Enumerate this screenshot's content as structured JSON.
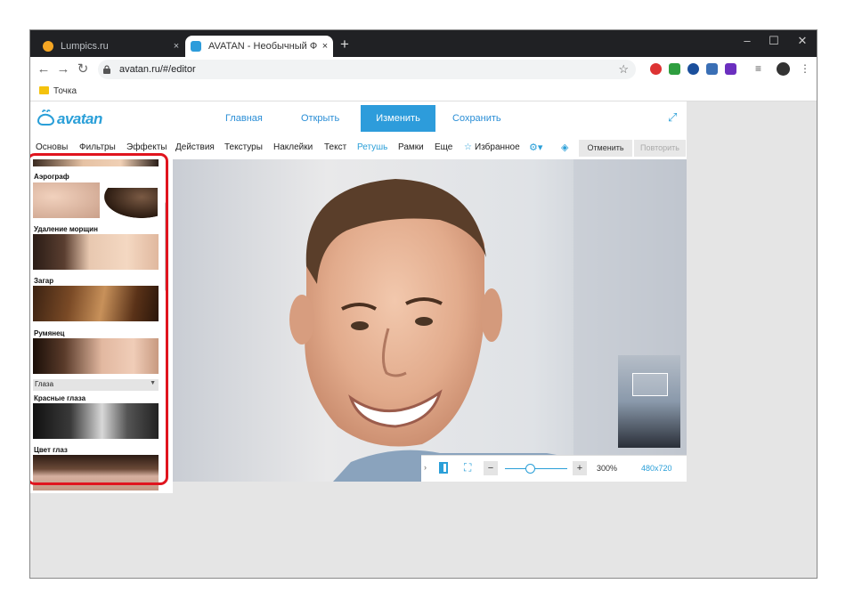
{
  "browser": {
    "tabs": [
      {
        "title": "Lumpics.ru",
        "close": "×"
      },
      {
        "title": "AVATAN - Необычный Фоторед",
        "close": "×"
      }
    ],
    "new_tab": "+",
    "window_controls": {
      "minimize": "–",
      "maximize": "☐",
      "close": "✕"
    },
    "url": "avatan.ru/#/editor",
    "bookmark": "Точка",
    "colors": {
      "tabstrip": "#202124",
      "accent": "#2d9cdb"
    }
  },
  "app": {
    "logo": "avatan",
    "nav": {
      "home": "Главная",
      "open": "Открыть",
      "edit": "Изменить",
      "save": "Сохранить"
    },
    "menu": [
      "Основы",
      "Фильтры",
      "Эффекты",
      "Действия",
      "Текстуры",
      "Наклейки",
      "Текст",
      "Ретушь",
      "Рамки",
      "Еще"
    ],
    "active_menu": "Ретушь",
    "favorites": "Избранное",
    "undo": "Отменить",
    "redo": "Повторить"
  },
  "panel": {
    "items": [
      {
        "label": "Аэрограф"
      },
      {
        "label": "Удаление морщин"
      },
      {
        "label": "Загар"
      },
      {
        "label": "Румянец"
      }
    ],
    "section": "Глаза",
    "eye_items": [
      {
        "label": "Красные глаза"
      },
      {
        "label": "Цвет глаз"
      }
    ]
  },
  "zoom": {
    "minus": "−",
    "plus": "+",
    "level": "300%",
    "size": "480x720",
    "slider_fraction": 0.4
  }
}
